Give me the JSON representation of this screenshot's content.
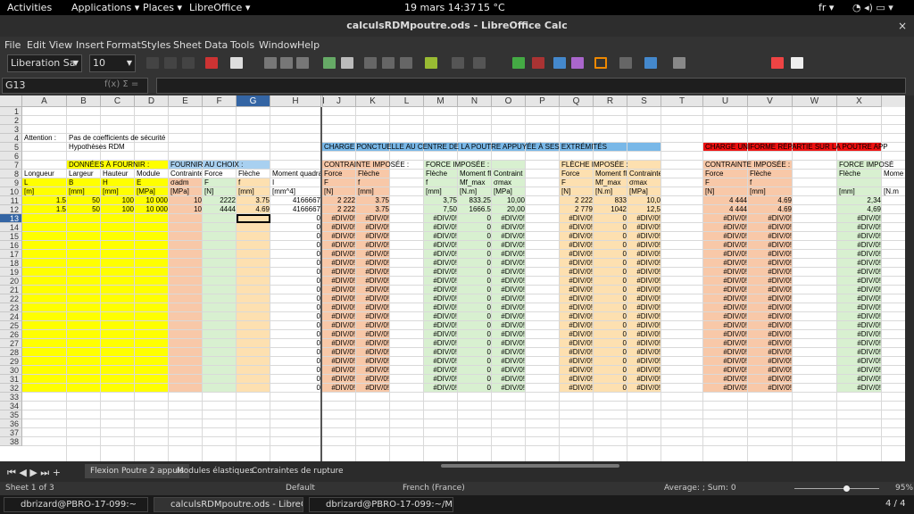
{
  "topbar": {
    "activities": "Activities",
    "applications": "Applications ▾",
    "places": "Places ▾",
    "app": "LibreOffice ▾",
    "datetime": "19 mars  14:37",
    "weather": "15 °C",
    "lang": "fr ▾"
  },
  "window": {
    "title": "calculsRDMpoutre.ods - LibreOffice Calc",
    "close": "×"
  },
  "menu": [
    "File",
    "Edit",
    "View",
    "Insert",
    "Format",
    "Styles",
    "Sheet",
    "Data",
    "Tools",
    "Window",
    "Help"
  ],
  "toolbar": {
    "font_name": "Liberation Sa",
    "font_size": "10"
  },
  "formula": {
    "cell_ref": "G13",
    "fx": "f(x)  Σ  ="
  },
  "columns": [
    "A",
    "B",
    "C",
    "D",
    "E",
    "F",
    "G",
    "H",
    "I",
    "J",
    "K",
    "L",
    "M",
    "N",
    "O",
    "P",
    "Q",
    "R",
    "S",
    "T",
    "U",
    "V",
    "W",
    "X"
  ],
  "row_numbers": [
    "1",
    "2",
    "3",
    "4",
    "5",
    "6",
    "7",
    "8",
    "9",
    "10",
    "11",
    "12",
    "13",
    "14",
    "15",
    "16",
    "17",
    "18",
    "19",
    "20",
    "21",
    "22",
    "23",
    "24",
    "25",
    "26",
    "27",
    "28",
    "29",
    "30",
    "31",
    "32",
    "33",
    "34",
    "35",
    "36",
    "37",
    "38"
  ],
  "texts": {
    "a4": "Attention :",
    "b4": "Pas de coefficients de sécurité",
    "b5": "Hypothèses RDM",
    "j5": "CHARGE PONCTUELLE AU CENTRE DE LA POUTRE APPUYÉE À SES EXTRÉMITÉS",
    "u5": "CHARGE UNIFORME RÉPARTIE SUR LA POUTRE APP",
    "b7": "DONNÉES À FOURNIR :",
    "e7": "FOURNIR AU CHOIX :",
    "j7": "CONTRAINTE IMPOSÉE :",
    "m7": "FORCE IMPOSÉE :",
    "q7": "FLÈCHE IMPOSÉE :",
    "u7": "CONTRAINTE IMPOSÉE :",
    "x7": "FORCE IMPOSÉ",
    "a8": "Longueur",
    "b8": "Largeur",
    "c8": "Hauteur",
    "d8": "Module",
    "e8": "Contrainte",
    "f8": "Force",
    "g8": "Flèche",
    "h8": "Moment quadra",
    "j8": "Force",
    "k8": "Flèche",
    "m8": "Flèche",
    "n8": "Moment fl",
    "o8": "Contraint",
    "q8": "Force",
    "r8": "Moment fl",
    "s8": "Contrainte",
    "u8": "Force",
    "v8": "Flèche",
    "x8": "Flèche",
    "y8": "Mome",
    "a9": "L",
    "b9": "B",
    "c9": "H",
    "d9": "E",
    "e9": "σadm",
    "f9": "F",
    "g9": "f",
    "h9": "I",
    "j9": "F",
    "k9": "f",
    "m9": "f",
    "n9": "Mf_max",
    "o9": "σmax",
    "q9": "F",
    "r9": "Mf_max",
    "s9": "σmax",
    "u9": "F",
    "v9": "f",
    "a10": "[m]",
    "b10": "[mm]",
    "c10": "[mm]",
    "d10": "[MPa]",
    "e10": "[MPa]",
    "f10": "[N]",
    "g10": "[mm]",
    "h10": "[mm^4]",
    "j10": "[N]",
    "k10": "[mm]",
    "m10": "[mm]",
    "n10": "[N.m]",
    "o10": "[MPa]",
    "q10": "[N]",
    "r10": "[N.m]",
    "s10": "[MPa]",
    "u10": "[N]",
    "v10": "[mm]",
    "x10": "[mm]",
    "y10": "[N.m"
  },
  "row11": [
    "1.5",
    "50",
    "100",
    "10 000",
    "10",
    "2222",
    "3.75",
    "4166667",
    "2 222",
    "3.75",
    "3,75",
    "833.25",
    "10,00",
    "2 222",
    "833",
    "10,0",
    "4 444",
    "4.69",
    "2,34"
  ],
  "row12": [
    "1.5",
    "50",
    "100",
    "10 000",
    "10",
    "4444",
    "4.69",
    "4166667",
    "2 222",
    "3.75",
    "7,50",
    "1666.5",
    "20,00",
    "2 779",
    "1042",
    "12,5",
    "4 444",
    "4.69",
    "4,69"
  ],
  "err": "#DIV/0!",
  "zero": "0",
  "sheets": {
    "tab1": "Flexion Poutre 2 appuis",
    "tab2": "Modules élastiques",
    "tab3": "Contraintes de rupture"
  },
  "status": {
    "sheet": "Sheet 1 of 3",
    "style": "Default",
    "lang": "French (France)",
    "sum": "Average: ; Sum: 0",
    "zoom": "95%"
  },
  "taskbar": {
    "t1": "dbrizard@PBRO-17-099:~",
    "t2": "calculsRDMpoutre.ods - LibreOffic...",
    "t3": "dbrizard@PBRO-17-099:~/Miscell...",
    "ws": "4 / 4"
  }
}
